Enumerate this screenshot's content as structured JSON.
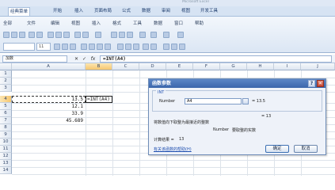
{
  "window": {
    "title": "Microsoft Excel"
  },
  "tabs": [
    {
      "label": "经典菜单",
      "active": true
    },
    {
      "label": "开始",
      "active": false
    },
    {
      "label": "插入",
      "active": false
    },
    {
      "label": "页面布局",
      "active": false
    },
    {
      "label": "公式",
      "active": false
    },
    {
      "label": "数据",
      "active": false
    },
    {
      "label": "审阅",
      "active": false
    },
    {
      "label": "视图",
      "active": false
    },
    {
      "label": "开发工具",
      "active": false
    }
  ],
  "ribbon": {
    "row1": [
      "全部",
      "文件",
      "编辑",
      "视图",
      "插入",
      "格式",
      "工具",
      "数据",
      "窗口",
      "帮助"
    ],
    "font_size": "11"
  },
  "formula_bar": {
    "name_box": "加数",
    "cancel_symbol": "✕",
    "enter_symbol": "✓",
    "fx_label": "fx",
    "formula": "=INT(A4)"
  },
  "sheet": {
    "columns": [
      "A",
      "B",
      "C",
      "D",
      "E",
      "F",
      "G",
      "H",
      "I",
      "J"
    ],
    "selected_column": "B",
    "rows": [
      "1",
      "2",
      "3",
      "4",
      "5",
      "6",
      "7",
      "8",
      "9",
      "10",
      "11",
      "12",
      "13",
      "14"
    ],
    "selected_row": "4",
    "cells": [
      {
        "row": "4",
        "col": "A",
        "value": "13.5"
      },
      {
        "row": "5",
        "col": "A",
        "value": "12.1"
      },
      {
        "row": "6",
        "col": "A",
        "value": "33.9"
      },
      {
        "row": "7",
        "col": "A",
        "value": "45.689"
      }
    ],
    "editing_cell": {
      "ref": "B4",
      "text": "=INT(A4)"
    }
  },
  "dialog": {
    "title": "函数参数",
    "help_button": "?",
    "close_button": "✕",
    "function_name": "INT",
    "arg_label": "Number",
    "arg_value": "A4",
    "arg_result": "= 13.5",
    "func_result": "= 13",
    "description": "将数值向下取整为最接近的整数",
    "arg_description_label": "Number",
    "arg_description": "要取整的实数",
    "calc_result_label": "计算结果 =",
    "calc_result_value": "13",
    "help_link": "有关该函数的帮助(H)",
    "ok_label": "确定",
    "cancel_label": "取消"
  }
}
